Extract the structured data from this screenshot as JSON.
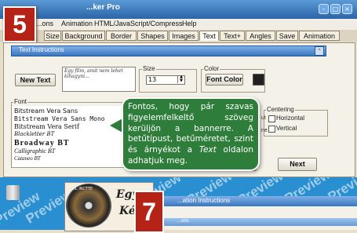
{
  "app": {
    "title": "...ker Pro"
  },
  "window_buttons": [
    "–",
    "□",
    "×"
  ],
  "menu": [
    "...ons",
    "Animation",
    "HTML/JavaScript/Compress",
    "Help"
  ],
  "tabs": [
    "Size",
    "Background",
    "Border",
    "Shapes",
    "Images",
    "Text",
    "Text+",
    "Angles",
    "Save",
    "Animation"
  ],
  "active_tab": "Text",
  "step_badges": {
    "first": "5",
    "second": "7"
  },
  "text_instructions": {
    "title": "Text Instructions",
    "toggle_icon": "chevron-up-icon"
  },
  "new_text_button": "New Text",
  "text_input": {
    "value": "Egy film, amit nem lehet kihagyni..."
  },
  "size": {
    "label": "Size",
    "value": "13"
  },
  "color": {
    "label": "Color",
    "button": "Font Color",
    "swatch": "#202020"
  },
  "font": {
    "label": "Font",
    "items": [
      "Bitstream Vera Sans",
      "Bitstream Vera Sans Mono",
      "Bitstream Vera Serif",
      "Blackletter BT",
      "Broadway BT",
      "Calligraphic BT",
      "Cataneo BT"
    ]
  },
  "partial_labels": [
    "ut",
    "ne"
  ],
  "centering": {
    "label": "Centering",
    "horizontal": "Horizontal",
    "vertical": "Vertical"
  },
  "next_button": "Next",
  "callout": {
    "part1": "Fontos, hogy pár szavas figyelemfelkeltő szöveg kerüljön a bannerre. A betűtípust, betűméretet, szint és árnyékot a ",
    "italic": "Text",
    "part2": " oldalon adhatjuk meg."
  },
  "watermark": "Preview",
  "thumbnail": {
    "small_text": "FIIL INCTTE",
    "line1": "Egy",
    "line2": "Ké"
  },
  "second_window": {
    "title": "...ation Instructions",
    "subtitle": "...ons"
  },
  "colors": {
    "accent": "#3a76c0",
    "callout_bg": "#2f7d3a",
    "badge_red": "#b52316",
    "strip_blue": "#2a8fd0"
  }
}
